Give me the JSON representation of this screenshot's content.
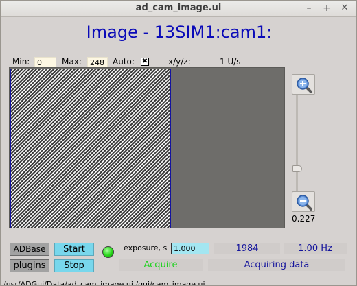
{
  "window": {
    "title": "ad_cam_image.ui",
    "controls": {
      "minimize": "–",
      "maximize": "+",
      "close": "✕"
    }
  },
  "heading": "Image - 13SIM1:cam1:",
  "display": {
    "min_label": "Min:",
    "min_value": "0",
    "max_label": "Max:",
    "max_value": "248",
    "auto_label": "Auto:",
    "auto_checked": "✖",
    "xyz_label": "x/y/z:",
    "rate": "1 U/s"
  },
  "zoom": {
    "value": "0.227",
    "zoom_in_icon": "zoom-in-icon",
    "zoom_out_icon": "zoom-out-icon"
  },
  "controls": {
    "adbase_label": "ADBase",
    "plugins_label": "plugins",
    "start_label": "Start",
    "stop_label": "Stop",
    "exposure_label": "exposure, s",
    "exposure_value": "1.000",
    "image_count": "1984",
    "frame_rate": "1.00 Hz",
    "acquire_text": "Acquire",
    "status_text": "Acquiring data"
  },
  "colors": {
    "heading": "#0a0ab8",
    "readback_text": "#14149c",
    "acquire_green": "#1cd21c",
    "control_button": "#78d7ec",
    "led": "#28d61a"
  },
  "footer_text": "/usr/ADGui/Data/ad_cam_image.ui  /gui/cam_image.ui"
}
